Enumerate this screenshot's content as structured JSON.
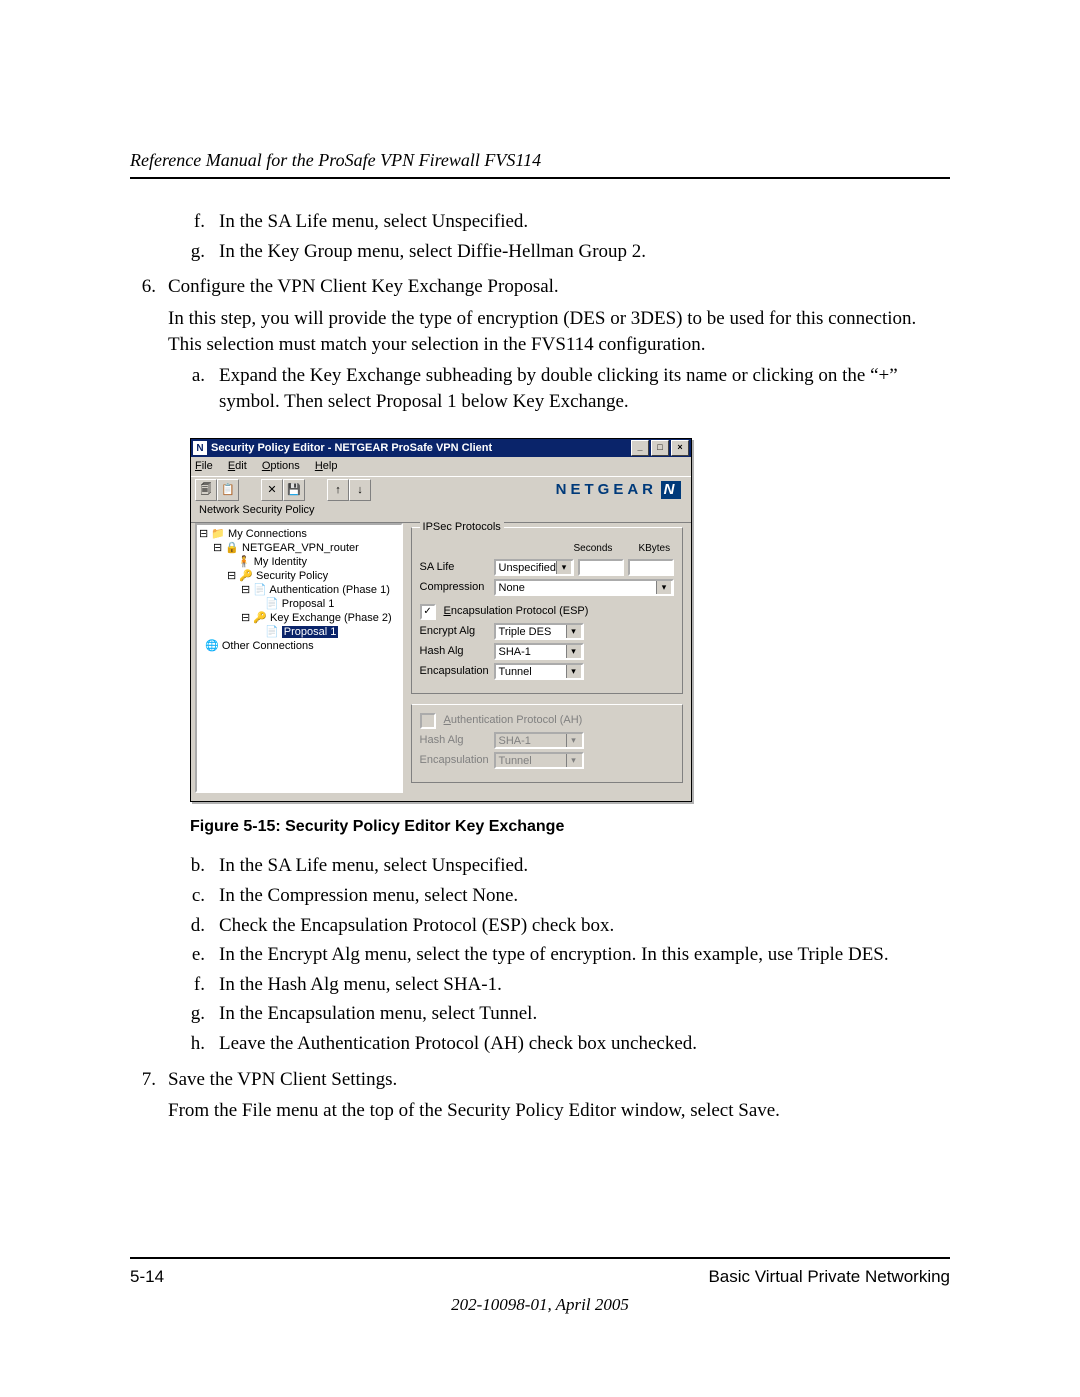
{
  "header": {
    "title": "Reference Manual for the ProSafe VPN Firewall FVS114"
  },
  "content": {
    "items_fg": {
      "f": "In the SA Life menu, select Unspecified.",
      "g": "In the Key Group menu, select Diffie-Hellman Group 2."
    },
    "step6": {
      "marker": "6.",
      "title": "Configure the VPN Client Key Exchange Proposal.",
      "para": "In this step, you will provide the type of encryption (DES or 3DES) to be used for this connection. This selection must match your selection in the FVS114 configuration.",
      "a": "Expand the Key Exchange subheading by double clicking its name or clicking on the “+” symbol. Then select Proposal 1 below Key Exchange."
    },
    "figcap": "Figure 5-15: Security Policy Editor Key Exchange",
    "sub_bh": {
      "b": "In the SA Life menu, select Unspecified.",
      "c": "In the Compression menu, select None.",
      "d": "Check the Encapsulation Protocol (ESP) check box.",
      "e": "In the Encrypt Alg menu, select the type of encryption. In this example, use Triple DES.",
      "f": "In the Hash Alg menu, select SHA-1.",
      "g": "In the Encapsulation menu, select Tunnel.",
      "h": "Leave the Authentication Protocol (AH) check box unchecked."
    },
    "step7": {
      "marker": "7.",
      "title": "Save the VPN Client Settings.",
      "para": "From the File menu at the top of the Security Policy Editor window, select Save."
    }
  },
  "screenshot": {
    "title": "Security Policy Editor - NETGEAR ProSafe VPN Client",
    "menus": {
      "file": "File",
      "edit": "Edit",
      "options": "Options",
      "help": "Help"
    },
    "brand": "NETGEAR",
    "panel_label": "Network Security Policy",
    "tree": {
      "root": "My Connections",
      "conn": "NETGEAR_VPN_router",
      "identity": "My Identity",
      "secpol": "Security Policy",
      "auth": "Authentication (Phase 1)",
      "prop1a": "Proposal 1",
      "kex": "Key Exchange (Phase 2)",
      "prop1b": "Proposal 1",
      "other": "Other Connections"
    },
    "ipsec": {
      "group": "IPSec Protocols",
      "col_seconds": "Seconds",
      "col_kbytes": "KBytes",
      "sa_life_label": "SA Life",
      "sa_life_value": "Unspecified",
      "compression_label": "Compression",
      "compression_value": "None",
      "esp_check": "✓",
      "esp_label": "Encapsulation Protocol (ESP)",
      "encrypt_label": "Encrypt Alg",
      "encrypt_value": "Triple DES",
      "hash_label": "Hash Alg",
      "hash_value": "SHA-1",
      "encap_label": "Encapsulation",
      "encap_value": "Tunnel",
      "ah_label": "Authentication Protocol (AH)",
      "ah_hash_label": "Hash Alg",
      "ah_hash_value": "SHA-1",
      "ah_encap_label": "Encapsulation",
      "ah_encap_value": "Tunnel"
    }
  },
  "footer": {
    "page": "5-14",
    "section": "Basic Virtual Private Networking",
    "docid": "202-10098-01, April 2005"
  }
}
